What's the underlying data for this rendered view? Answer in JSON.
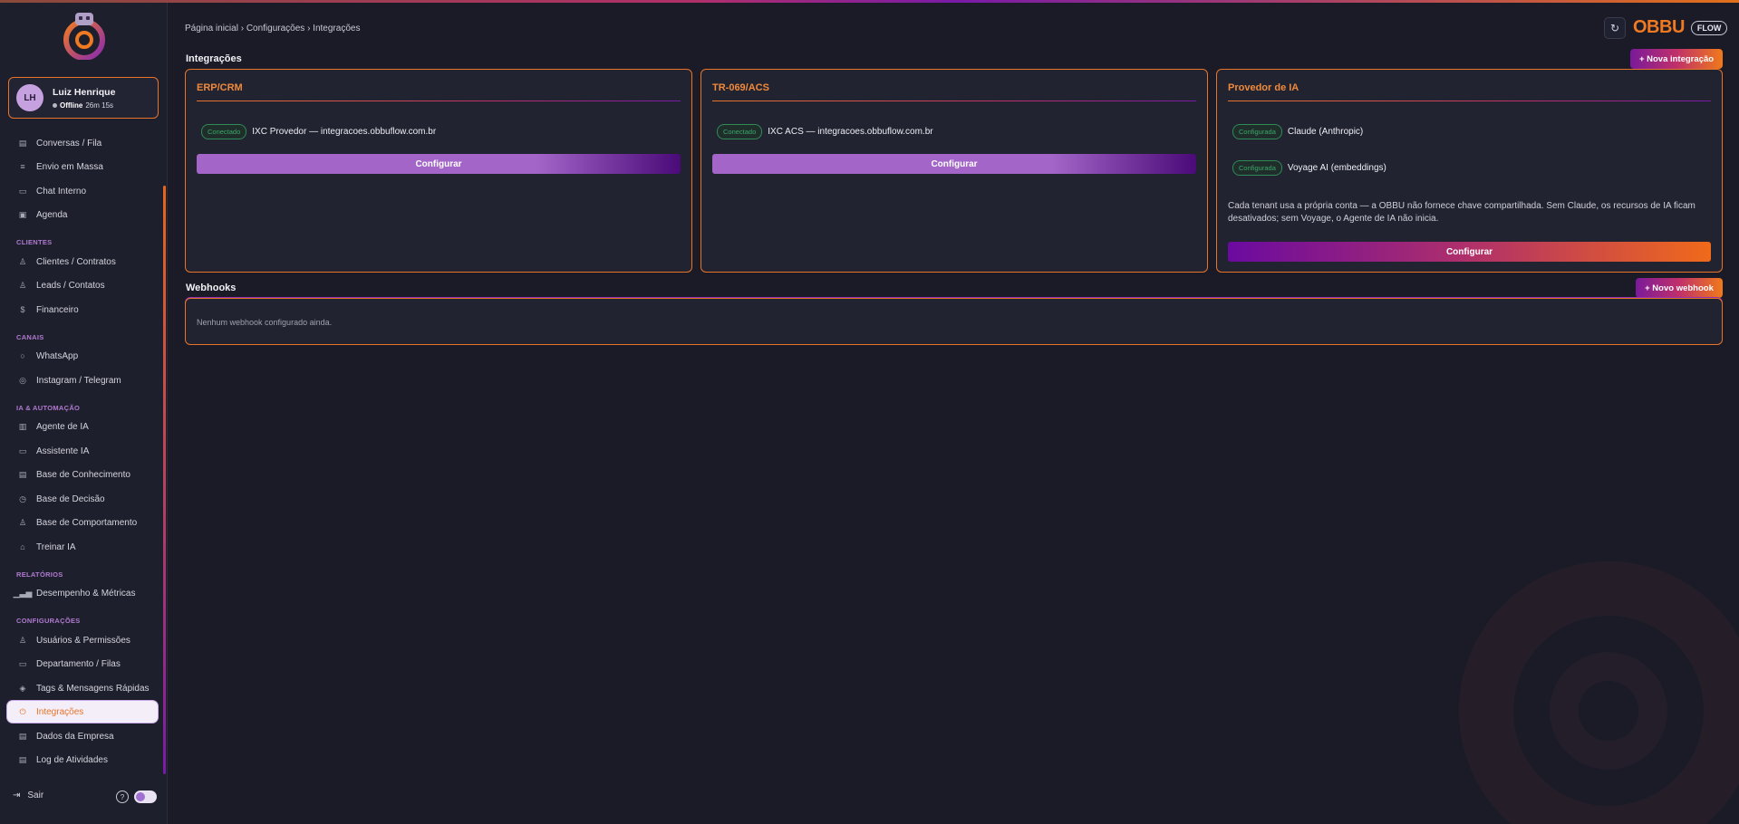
{
  "user": {
    "initials": "LH",
    "name": "Luiz Henrique",
    "status": "Offline",
    "duration": "26m 15s"
  },
  "nav": {
    "items": [
      {
        "label": "Conversas / Fila",
        "icon": "clipboard-icon"
      },
      {
        "label": "Envio em Massa",
        "icon": "lines-icon"
      },
      {
        "label": "Chat Interno",
        "icon": "chat-icon"
      },
      {
        "label": "Agenda",
        "icon": "calendar-icon"
      },
      {
        "label": "Clientes / Contratos",
        "icon": "user-icon"
      },
      {
        "label": "Leads / Contatos",
        "icon": "users-icon"
      },
      {
        "label": "Financeiro",
        "icon": "dollar-icon"
      },
      {
        "label": "WhatsApp",
        "icon": "whatsapp-icon"
      },
      {
        "label": "Instagram / Telegram",
        "icon": "instagram-icon"
      },
      {
        "label": "Agente de IA",
        "icon": "robot-icon"
      },
      {
        "label": "Assistente IA",
        "icon": "chat-icon"
      },
      {
        "label": "Base de Conhecimento",
        "icon": "book-icon"
      },
      {
        "label": "Base de Decisão",
        "icon": "clock-icon"
      },
      {
        "label": "Base de Comportamento",
        "icon": "user-icon"
      },
      {
        "label": "Treinar IA",
        "icon": "lock-icon"
      },
      {
        "label": "Desempenho & Métricas",
        "icon": "bars-icon"
      },
      {
        "label": "Usuários & Permissões",
        "icon": "users-icon"
      },
      {
        "label": "Departamento / Filas",
        "icon": "briefcase-icon"
      },
      {
        "label": "Tags & Mensagens Rápidas",
        "icon": "tag-icon"
      },
      {
        "label": "Integrações",
        "icon": "plug-icon"
      },
      {
        "label": "Dados da Empresa",
        "icon": "building-icon"
      },
      {
        "label": "Log de Atividades",
        "icon": "log-icon"
      }
    ],
    "sections": [
      "Clientes",
      "Canais",
      "IA & Automação",
      "Relatórios",
      "Configurações"
    ],
    "logout": "Sair",
    "help": "?"
  },
  "breadcrumb": "Página inicial › Configurações › Integrações",
  "brand": {
    "name": "OBBU",
    "tag": "FLOW"
  },
  "integrations": {
    "title": "Integrações",
    "new_button": "+ Nova integração",
    "cards": [
      {
        "title": "ERP/CRM",
        "rows": [
          {
            "badge": "Conectado",
            "text": "IXC Provedor — integracoes.obbuflow.com.br"
          }
        ],
        "button": "Configurar"
      },
      {
        "title": "TR-069/ACS",
        "rows": [
          {
            "badge": "Conectado",
            "text": "IXC ACS — integracoes.obbuflow.com.br"
          }
        ],
        "button": "Configurar"
      },
      {
        "title": "Provedor de IA",
        "rows": [
          {
            "badge": "Configurada",
            "text": "Claude (Anthropic)"
          },
          {
            "badge": "Configurada",
            "text": "Voyage AI (embeddings)"
          }
        ],
        "note": "Cada tenant usa a própria conta — a OBBU não fornece chave compartilhada. Sem Claude, os recursos de IA ficam desativados; sem Voyage, o Agente de IA não inicia.",
        "button": "Configurar"
      }
    ]
  },
  "webhooks": {
    "title": "Webhooks",
    "new_button": "+ Novo webhook",
    "empty": "Nenhum webhook configurado ainda."
  },
  "colors": {
    "accent": "#e8742a",
    "purple": "#7a1aa8",
    "success": "#3aa86a"
  }
}
